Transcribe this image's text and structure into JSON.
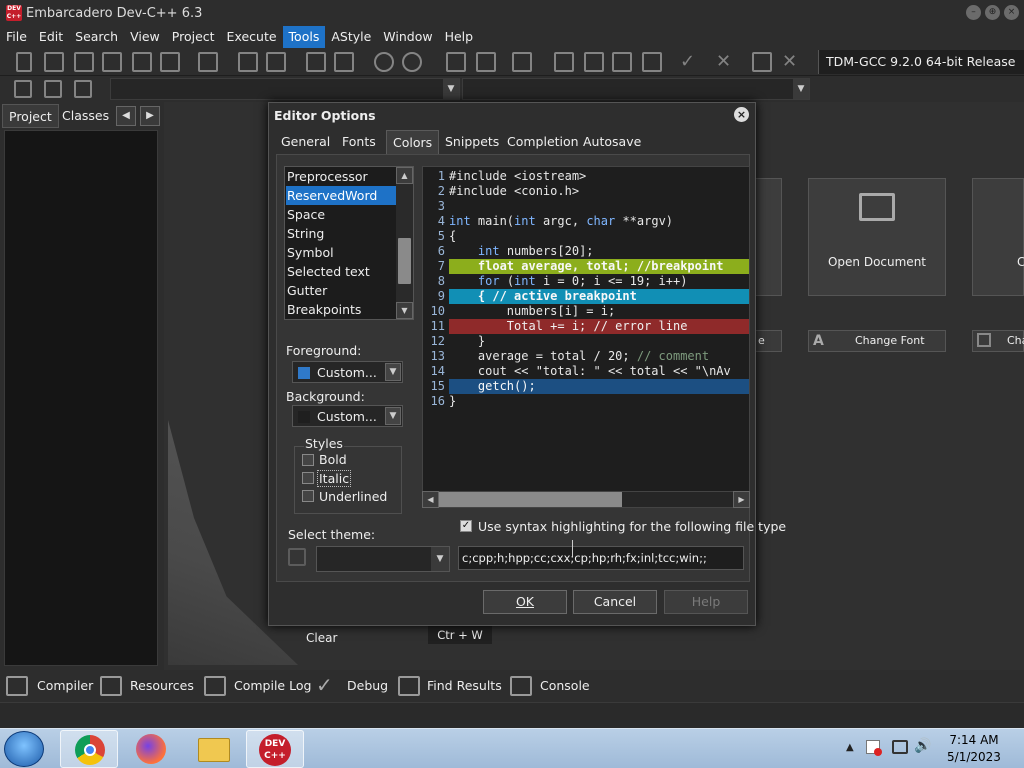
{
  "window": {
    "title": "Embarcadero Dev-C++ 6.3",
    "app_icon_text": "DEV C++"
  },
  "menu": [
    "File",
    "Edit",
    "Search",
    "View",
    "Project",
    "Execute",
    "Tools",
    "AStyle",
    "Window",
    "Help"
  ],
  "menu_active": "Tools",
  "compiler_select": "TDM-GCC 9.2.0 64-bit Release",
  "left_tabs": [
    "Project",
    "Classes"
  ],
  "welcome": {
    "open_document": "Open Document",
    "change_font": "Change Font",
    "partial_left": "e",
    "partial_right": "Cha",
    "partial_tile": "C"
  },
  "clear_label": "Clear",
  "shortcut": "Ctr + W",
  "bottom_tabs": [
    "Compiler",
    "Resources",
    "Compile Log",
    "Debug",
    "Find Results",
    "Console"
  ],
  "taskbar": {
    "time": "7:14 AM",
    "date": "5/1/2023"
  },
  "dialog": {
    "title": "Editor Options",
    "tabs": [
      "General",
      "Fonts",
      "Colors",
      "Snippets",
      "Completion",
      "Autosave"
    ],
    "selected_tab": "Colors",
    "list_items": [
      "Preprocessor",
      "ReservedWord",
      "Space",
      "String",
      "Symbol",
      "Selected text",
      "Gutter",
      "Breakpoints"
    ],
    "selected_item": "ReservedWord",
    "foreground_label": "Foreground:",
    "foreground_value": "Custom...",
    "background_label": "Background:",
    "background_value": "Custom...",
    "styles_label": "Styles",
    "styles": [
      {
        "label": "Bold",
        "checked": false
      },
      {
        "label": "Italic",
        "checked": false
      },
      {
        "label": "Underlined",
        "checked": false
      }
    ],
    "code_lines": [
      "#include <iostream>",
      "#include <conio.h>",
      "",
      "int main(int argc, char **argv)",
      "{",
      "    int numbers[20];",
      "    float average, total; //breakpoint",
      "    for (int i = 0; i <= 19; i++)",
      "    { // active breakpoint",
      "        numbers[i] = i;",
      "        Total += i; // error line",
      "    }",
      "    average = total / 20; // comment",
      "    cout << \"total: \" << total << \"\\nAv",
      "    getch();",
      "}"
    ],
    "use_syntax_label": "Use syntax highlighting for the following file type",
    "use_syntax_checked": true,
    "select_theme_label": "Select theme:",
    "file_types": "c;cpp;h;hpp;cc;cxx;cp;hp;rh;fx;inl;tcc;win;;",
    "buttons": {
      "ok": "OK",
      "cancel": "Cancel",
      "help": "Help"
    },
    "colors": {
      "foreground_swatch": "#2f79c9",
      "background_swatch": "#1f1f1f",
      "breakpoint_line": "#8cae1c",
      "active_breakpoint_line": "#118fb5",
      "error_line": "#8f2a2a",
      "selected_line": "#1c4f82"
    }
  }
}
